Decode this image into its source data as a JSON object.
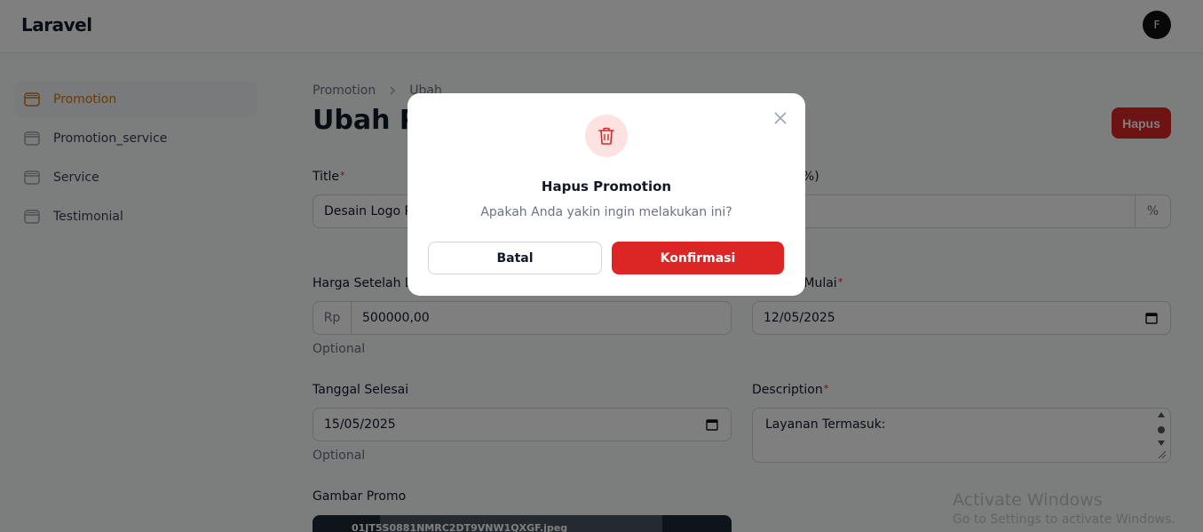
{
  "app": {
    "brand": "Laravel",
    "user_initial": "F"
  },
  "sidebar": {
    "items": [
      {
        "label": "Promotion",
        "icon": "database-icon",
        "active": true
      },
      {
        "label": "Promotion_service",
        "icon": "database-icon",
        "active": false
      },
      {
        "label": "Service",
        "icon": "database-icon",
        "active": false
      },
      {
        "label": "Testimonial",
        "icon": "database-icon",
        "active": false
      }
    ]
  },
  "breadcrumb": {
    "parent": "Promotion",
    "current": "Ubah"
  },
  "header": {
    "title": "Ubah Promotion",
    "delete_label": "Hapus"
  },
  "form": {
    "title": {
      "label": "Title",
      "value": "Desain Logo Profesional"
    },
    "discount": {
      "label": "Diskon (%)",
      "suffix": "%"
    },
    "price_after": {
      "label": "Harga Setelah Diskon",
      "prefix": "Rp",
      "value": "500000,00",
      "hint": "Optional"
    },
    "start_date": {
      "label": "Tanggal Mulai",
      "value": "12/05/2025"
    },
    "end_date": {
      "label": "Tanggal Selesai",
      "value": "15/05/2025",
      "hint": "Optional"
    },
    "description": {
      "label": "Description",
      "value": "Layanan Termasuk:"
    },
    "image": {
      "label": "Gambar Promo",
      "filename": "01JT5S0881NMRC2DT9VNW1QXGF.jpeg"
    }
  },
  "modal": {
    "icon": "trash-icon",
    "title": "Hapus Promotion",
    "description": "Apakah Anda yakin ingin melakukan ini?",
    "cancel_label": "Batal",
    "confirm_label": "Konfirmasi"
  },
  "watermark": {
    "title": "Activate Windows",
    "subtitle": "Go to Settings to activate Windows."
  },
  "colors": {
    "accent": "#d97706",
    "danger": "#dc2626",
    "danger_soft": "#fee2e2"
  }
}
